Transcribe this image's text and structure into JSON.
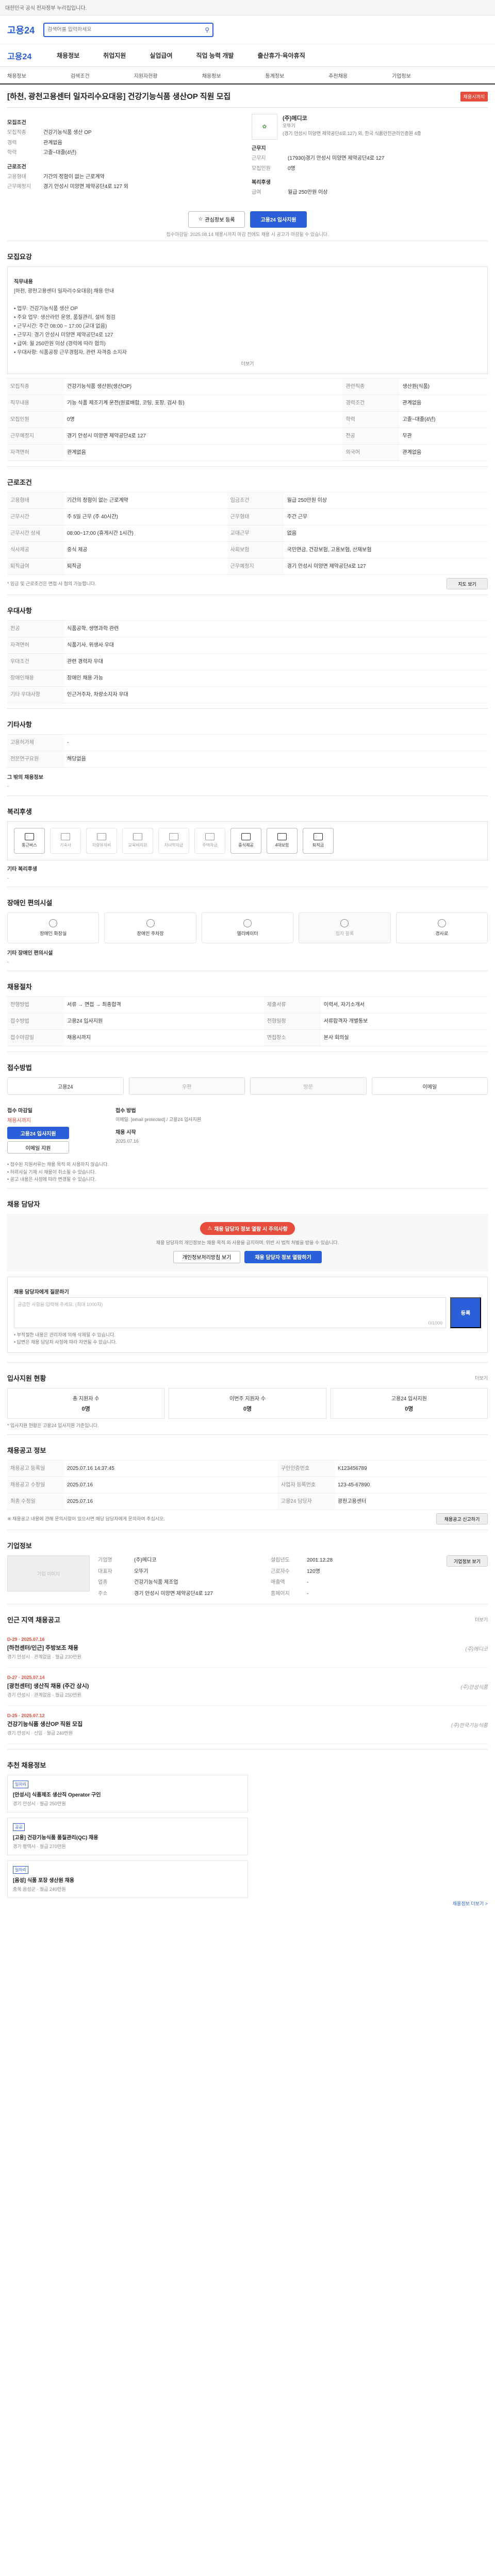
{
  "topbar": {
    "text": "대한민국 공식 전자정부 누리집입니다."
  },
  "header": {
    "logo": "고용24",
    "search_placeholder": "검색어를 입력하세요"
  },
  "gnb": [
    "고용24",
    "채용정보",
    "취업지원",
    "실업급여",
    "직업 능력 개발",
    "출산휴가·육아휴직"
  ],
  "subnav": [
    "채용정보",
    "검색조건",
    "지원자현황",
    "채용정보",
    "통계정보",
    "추천채용",
    "기업정보"
  ],
  "posting": {
    "title": "[하천, 광천고용센터 일자리수요대응] 건강기능식품 생산OP 직원 모집",
    "tag": "채용시까지",
    "company": {
      "name": "(주)메디코",
      "rep": "오뚜기",
      "addr": "(경기 안성시 미양면 제약공단4로 127) 외, 한국 식품안전관리인증원 4층"
    },
    "summary_left": [
      {
        "k": "모집직종",
        "v": "건강기능식품 생산 OP"
      },
      {
        "k": "경력",
        "v": "관계없음"
      },
      {
        "k": "학력",
        "v": "고졸~대졸(4년)"
      }
    ],
    "summary_left_head": "모집조건",
    "summary_left2": [
      {
        "k": "고용형태",
        "v": "기간의 정함이 없는 근로계약"
      },
      {
        "k": "근무예정지",
        "v": "경기 안성시 미양면 제약공단4로 127 외"
      }
    ],
    "summary_left2_head": "근로조건",
    "summary_right_head": "근무지",
    "summary_right": [
      {
        "k": "근무지",
        "v": "(17930)경기 안성시 미양면 제약공단4로 127"
      },
      {
        "k": "모집인원",
        "v": "0명"
      }
    ],
    "summary_right2_head": "복리후생",
    "summary_right2": [
      {
        "k": "급여",
        "v": "월급 250만원 이상"
      }
    ],
    "apply_outline": "관심정보 등록",
    "apply_main": "고용24 입사지원",
    "apply_note": "접수마감일: 2025.08.14 채용시까지 마감 전에도 채용 시 공고가 마감될 수 있습니다."
  },
  "sections": {
    "job_desc_title": "모집요강",
    "job_desc_head": "직무내용",
    "job_desc": "[하천, 광천고용센터 일자리수요대응] 채용 안내\n\n• 업무: 건강기능식품 생산 OP\n• 주요 업무: 생산라인 운영, 품질관리, 설비 점검\n• 근무시간: 주간 08:00 ~ 17:00 (교대 없음)\n• 근무지: 경기 안성시 미양면 제약공단4로 127\n• 급여: 월 250만원 이상 (경력에 따라 협의)\n• 우대사항: 식품공장 근무경험자, 관련 자격증 소지자",
    "job_desc_more": "더보기",
    "job_grid": [
      {
        "k": "모집직종",
        "v": "건강기능식품 생산원(생산OP)",
        "k2": "관련직종",
        "v2": "생산원(식품)"
      },
      {
        "k": "직무내용",
        "v": "기능 식품 제조기계 운전(원료배합, 코팅, 포장, 검사 등)",
        "k2": "경력조건",
        "v2": "관계없음"
      },
      {
        "k": "모집인원",
        "v": "0명",
        "k2": "학력",
        "v2": "고졸~대졸(4년)"
      },
      {
        "k": "근무예정지",
        "v": "경기 안성시 미양면 제약공단4로 127",
        "k2": "전공",
        "v2": "무관"
      },
      {
        "k": "자격면허",
        "v": "관계없음",
        "k2": "외국어",
        "v2": "관계없음"
      }
    ],
    "cond_title": "근로조건",
    "cond_grid": [
      {
        "k": "고용형태",
        "v": "기간의 정함이 없는 근로계약",
        "k2": "임금조건",
        "v2": "월급 250만원 이상"
      },
      {
        "k": "근무시간",
        "v": "주 5일 근무 (주 40시간)",
        "k2": "근무형태",
        "v2": "주간 근무"
      },
      {
        "k": "근무시간 상세",
        "v": "08:00~17:00 (휴게시간 1시간)",
        "k2": "교대근무",
        "v2": "없음"
      },
      {
        "k": "식사제공",
        "v": "중식 제공",
        "k2": "사회보험",
        "v2": "국민연금, 건강보험, 고용보험, 산재보험"
      },
      {
        "k": "퇴직급여",
        "v": "퇴직금",
        "k2": "근무예정지",
        "v2": "경기 안성시 미양면 제약공단4로 127"
      }
    ],
    "cond_note": "* 임금 및 근로조건은 면접 시 협의 가능합니다.",
    "cond_map_btn": "지도 보기",
    "welfare_title": "우대사항",
    "welfare_grid": [
      {
        "k": "전공",
        "v": "식품공학, 생명과학 관련"
      },
      {
        "k": "자격면허",
        "v": "식품기사, 위생사 우대"
      },
      {
        "k": "우대조건",
        "v": "관련 경력자 우대"
      },
      {
        "k": "장애인채용",
        "v": "장애인 채용 가능"
      },
      {
        "k": "기타 우대사항",
        "v": "인근거주자, 차량소지자 우대"
      }
    ],
    "etc_title": "기타사항",
    "etc_grid": [
      {
        "k": "고용허가제",
        "v": "-"
      },
      {
        "k": "전문연구요원",
        "v": "해당없음"
      }
    ],
    "etc_sub": "그 밖의 채용정보",
    "etc_sub_val": "-",
    "benefit_title": "복리후생",
    "benefit_tiles": [
      {
        "label": "통근버스",
        "on": true
      },
      {
        "label": "기숙사",
        "on": false
      },
      {
        "label": "차량유지비",
        "on": false
      },
      {
        "label": "교육비지원",
        "on": false
      },
      {
        "label": "자녀학자금",
        "on": false
      },
      {
        "label": "주택자금",
        "on": false
      },
      {
        "label": "중식제공",
        "on": true
      },
      {
        "label": "4대보험",
        "on": true
      },
      {
        "label": "퇴직금",
        "on": true
      }
    ],
    "benefit_sub": "기타 복리후생",
    "benefit_sub_val": "-",
    "disability_title": "장애인 편의시설",
    "disability_tiles": [
      {
        "label": "장애인 화장실",
        "on": true
      },
      {
        "label": "장애인 주차장",
        "on": true
      },
      {
        "label": "엘리베이터",
        "on": true
      },
      {
        "label": "점자 블록",
        "on": false
      },
      {
        "label": "경사로",
        "on": true
      }
    ],
    "disability_sub": "기타 장애인 편의시설",
    "disability_sub_val": "-",
    "select_title": "채용절차",
    "select_grid": [
      {
        "k": "전형방법",
        "v": "서류 → 면접 → 최종합격",
        "k2": "제출서류",
        "v2": "이력서, 자기소개서"
      },
      {
        "k": "접수방법",
        "v": "고용24 입사지원",
        "k2": "전형일정",
        "v2": "서류합격자 개별통보"
      },
      {
        "k": "접수마감일",
        "v": "채용시까지",
        "k2": "면접장소",
        "v2": "본사 회의실"
      }
    ],
    "method_title": "접수방법",
    "methods": [
      {
        "label": "고용24",
        "on": true
      },
      {
        "label": "우편",
        "on": false
      },
      {
        "label": "방문",
        "on": false
      },
      {
        "label": "이메일",
        "on": true
      }
    ],
    "apply_left_title": "접수 마감일",
    "apply_left_val": "채용시까지",
    "apply_left_btn": "고용24 입사지원",
    "apply_left_btn2": "이메일 지원",
    "apply_right_title": "접수 방법",
    "apply_right_val": "이메일: [email protected] / 고용24 입사지원",
    "apply_right_title2": "채용 시작",
    "apply_right_val2": "2025.07.16",
    "apply_notes": "• 접수된 지원서류는 채용 목적 외 사용하지 않습니다.\n• 허위사실 기재 시 채용이 취소될 수 있습니다.\n• 공고 내용은 사정에 따라 변경될 수 있습니다.",
    "contact_title": "채용 담당자",
    "contact_pill": "채용 담당자 정보 열람 시 주의사항",
    "contact_text": "채용 담당자의 개인정보는 채용 목적 외 사용을 금지하며, 위반 시 법적 처벌을 받을 수 있습니다.",
    "contact_btn1": "개인정보처리방침 보기",
    "contact_btn2": "채용 담당자 정보 열람하기",
    "qa_title": "채용 담당자에게 질문하기",
    "qa_placeholder": "궁금한 사항을 입력해 주세요. (최대 1000자)",
    "qa_count": "0/1000",
    "qa_send": "등록",
    "qa_notes": "• 부적절한 내용은 관리자에 의해 삭제될 수 있습니다.\n• 답변은 채용 담당자 사정에 따라 지연될 수 있습니다.",
    "stats_title": "입사지원 현황",
    "stats_more": "더보기",
    "stats": [
      {
        "label": "총 지원자 수",
        "val": "0명"
      },
      {
        "label": "이번주 지원자 수",
        "val": "0명"
      },
      {
        "label": "고용24 입사지원",
        "val": "0명"
      }
    ],
    "stats_note": "* 입사지원 현황은 고용24 입사지원 기준입니다.",
    "history_title": "채용공고 정보",
    "history_grid": [
      {
        "k": "채용공고 등록일",
        "v": "2025.07.16 14:37:45",
        "k2": "구인인증번호",
        "v2": "K123456789"
      },
      {
        "k": "채용공고 수정일",
        "v": "2025.07.16",
        "k2": "사업자 등록번호",
        "v2": "123-45-67890"
      },
      {
        "k": "최종 수정일",
        "v": "2025.07.16",
        "k2": "고용24 담당자",
        "v2": "광천고용센터"
      }
    ],
    "history_notes": "※ 채용공고 내용에 관해 문의사항이 있으시면 해당 담당자에게 문의하여 주십시오.",
    "history_btn": "채용공고 신고하기",
    "company_title": "기업정보",
    "company_info": [
      {
        "k": "기업명",
        "v": "(주)메디코"
      },
      {
        "k": "설립년도",
        "v": "2001.12.28"
      },
      {
        "k": "대표자",
        "v": "오뚜기"
      },
      {
        "k": "근로자수",
        "v": "120명"
      },
      {
        "k": "업종",
        "v": "건강기능식품 제조업"
      },
      {
        "k": "매출액",
        "v": "-"
      },
      {
        "k": "주소",
        "v": "경기 안성시 미양면 제약공단4로 127"
      },
      {
        "k": "홈페이지",
        "v": "-"
      }
    ],
    "company_btn": "기업정보 보기",
    "company_img": "기업 이미지",
    "jobs_title": "인근 지역 채용공고",
    "jobs_more": "더보기",
    "jobs": [
      {
        "d": "D-29 · 2025.07.16",
        "t": "[하천센터/인근] 주방보조 채용",
        "m": "경기 안성시 · 관계없음 · 월급 230만원",
        "logo": "(주)메디코"
      },
      {
        "d": "D-27 · 2025.07.14",
        "t": "[광천센터] 생산직 채용 (주간 상시)",
        "m": "경기 안성시 · 관계없음 · 월급 250만원",
        "logo": "(주)안성식품"
      },
      {
        "d": "D-25 · 2025.07.12",
        "t": "건강기능식품 생산OP 직원 모집",
        "m": "경기 안성시 · 신입 · 월급 240만원",
        "logo": "(주)한국기능식품"
      }
    ],
    "recs_title": "추천 채용정보",
    "recs": [
      {
        "badge": "일자리",
        "t": "[안성시] 식품제조 생산직 Operator 구인",
        "m": "경기 안성시 · 월급 250만원"
      },
      {
        "badge": "공공",
        "t": "[고용] 건강기능식품 품질관리(QC) 채용",
        "m": "경기 평택시 · 월급 270만원"
      },
      {
        "badge": "일자리",
        "t": "[음성] 식품 포장 생산원 채용",
        "m": "충북 음성군 · 월급 240만원"
      }
    ],
    "recs_more": "채용정보 더보기 >"
  }
}
